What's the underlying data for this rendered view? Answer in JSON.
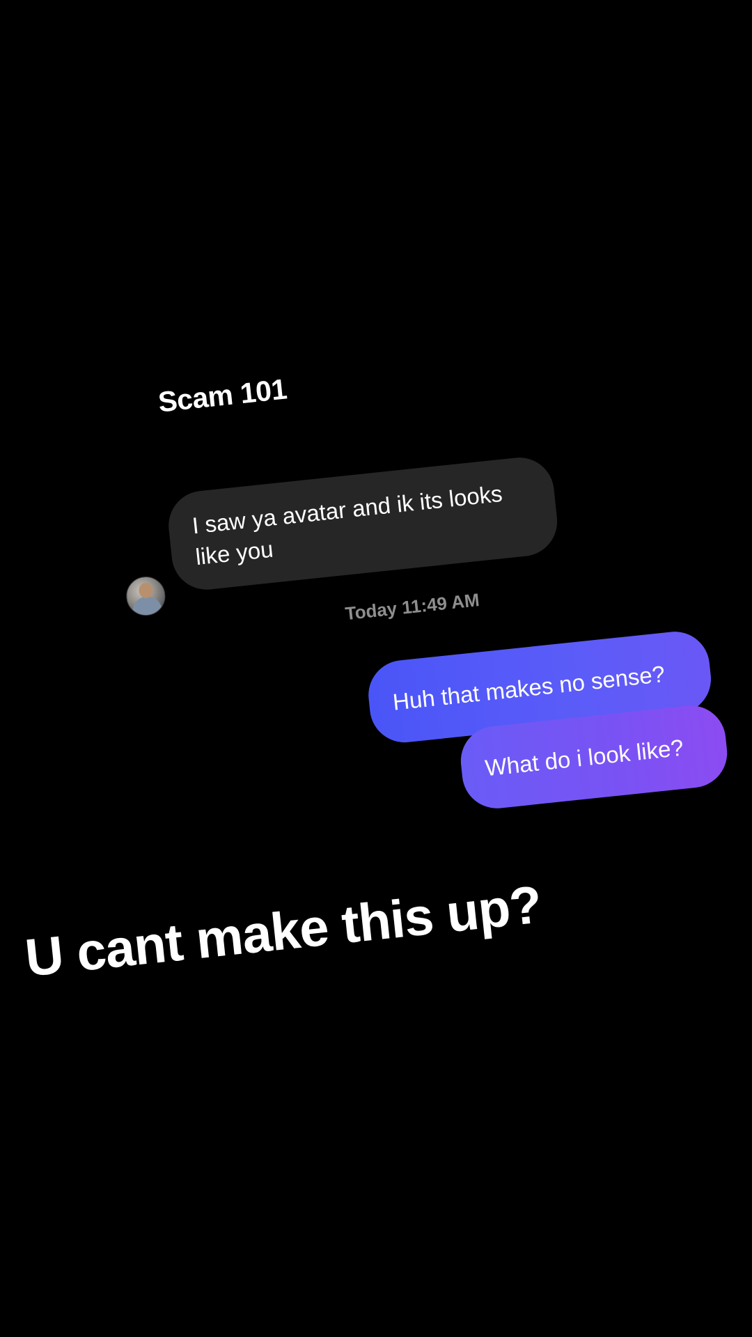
{
  "conversation": {
    "sender_name": "Scam 101",
    "incoming_message": "I saw ya avatar and ik its looks like you",
    "timestamp": "Today 11:49 AM",
    "outgoing_messages": [
      "Huh that makes no sense?",
      "What do i look like?"
    ]
  },
  "caption": "U cant make this up?",
  "colors": {
    "background": "#000000",
    "incoming_bubble": "#262626",
    "outgoing_gradient_start": "#4a55f7",
    "outgoing_gradient_end": "#8c4cf2",
    "timestamp_text": "#8e8e8e"
  },
  "icons": {
    "avatar": "user-avatar-photo"
  }
}
